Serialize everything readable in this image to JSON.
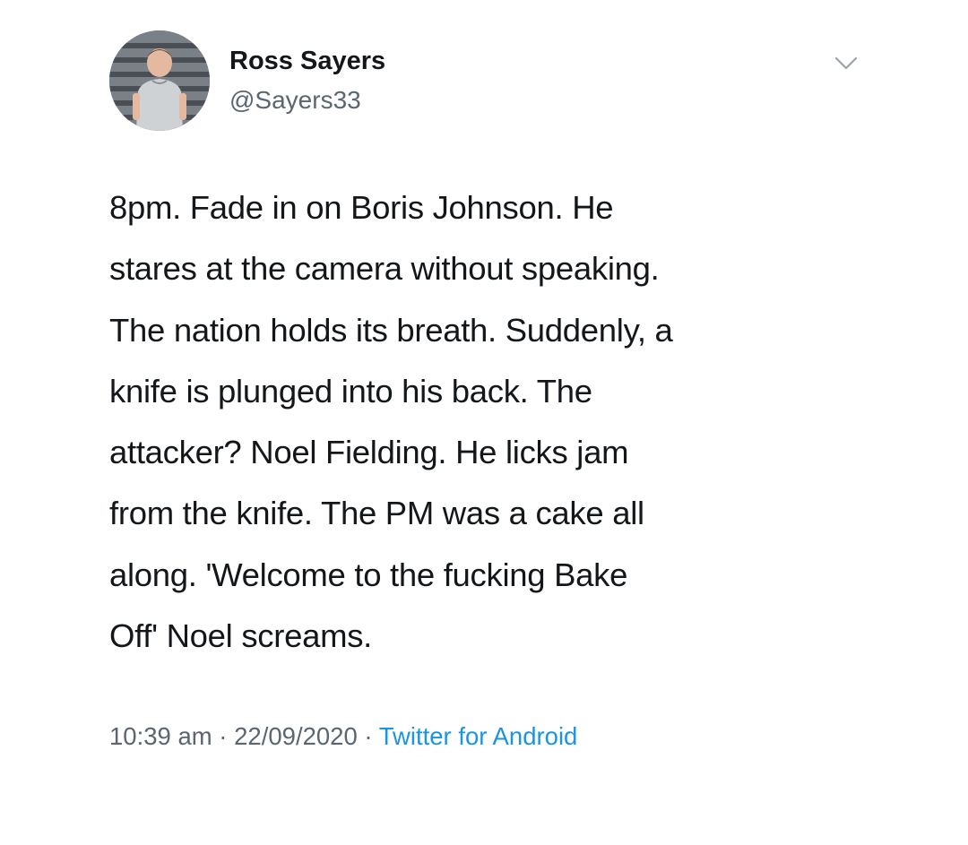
{
  "author": {
    "name": "Ross Sayers",
    "handle": "@Sayers33"
  },
  "tweet": {
    "lines": [
      "8pm. Fade in on Boris Johnson. He",
      "stares at the camera without speaking.",
      "The nation holds its breath. Suddenly, a",
      "knife is plunged into his back. The",
      "attacker? Noel Fielding. He licks jam",
      "from the knife. The PM was a cake all",
      "along. 'Welcome to the fucking Bake",
      "Off' Noel screams."
    ]
  },
  "meta": {
    "time": "10:39 am",
    "separator": " · ",
    "date": "22/09/2020",
    "source": "Twitter for Android"
  },
  "icons": {
    "menu": "chevron-down-icon"
  },
  "colors": {
    "text": "#14171a",
    "secondary": "#5b6670",
    "link": "#1b95e0",
    "background": "#ffffff"
  }
}
